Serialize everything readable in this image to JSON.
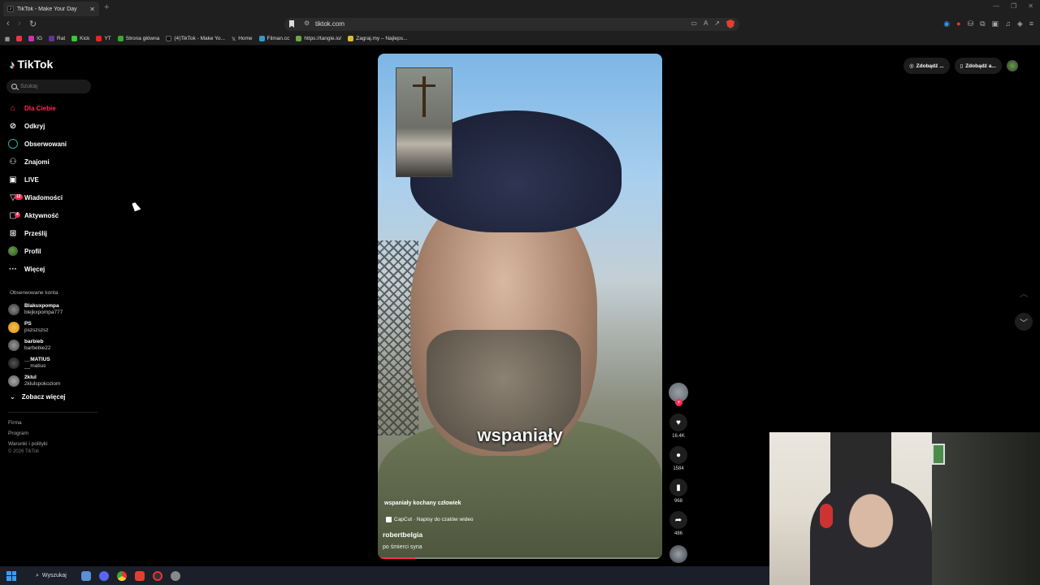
{
  "browser": {
    "tab_title": "TikTok - Make Your Day",
    "url": "tiktok.com",
    "bookmarks": [
      "IG",
      "Rat",
      "Kick",
      "YT",
      "Strona główna",
      "(4)TikTok - Make Yo...",
      "Home",
      "Filman.cc",
      "https://tangle.io/",
      "Zagraj.my – Najleps..."
    ]
  },
  "tiktok": {
    "logo": "TikTok",
    "search_placeholder": "Szukaj",
    "nav": [
      {
        "label": "Dla Ciebie",
        "icon": "home-icon"
      },
      {
        "label": "Odkryj",
        "icon": "compass-icon"
      },
      {
        "label": "Obserwowani",
        "icon": "following-icon"
      },
      {
        "label": "Znajomi",
        "icon": "friends-icon"
      },
      {
        "label": "LIVE",
        "icon": "live-icon"
      },
      {
        "label": "Wiadomości",
        "icon": "messages-icon",
        "badge": "12"
      },
      {
        "label": "Aktywność",
        "icon": "activity-icon",
        "badge": "4"
      },
      {
        "label": "Prześlij",
        "icon": "upload-icon"
      },
      {
        "label": "Profil",
        "icon": "profile-icon"
      },
      {
        "label": "Więcej",
        "icon": "more-icon"
      }
    ],
    "following_title": "Obserwowane konta",
    "accounts": [
      {
        "name": "Blakuxpompa",
        "handle": "blejkxpompa777"
      },
      {
        "name": "PS",
        "handle": "pszszszsz"
      },
      {
        "name": "barbieb",
        "handle": "barbebie22"
      },
      {
        "name": "__MATIUS",
        "handle": "__matius"
      },
      {
        "name": "2klul",
        "handle": "2klulspokoziom"
      }
    ],
    "see_more": "Zobacz więcej",
    "footer": [
      "Firma",
      "Program",
      "Warunki i polityki"
    ],
    "copyright": "© 2026 TikTok",
    "top_right": [
      "Zdobądź ...",
      "Zdobądź a..."
    ]
  },
  "video": {
    "caption": "wspaniały",
    "description": "wspaniały kochany człowiek",
    "capcut": "CapCut · Napisy do czatów wideo",
    "author": "robertbelgia",
    "subtitle": "po śmierci syna",
    "progress": 0.13,
    "likes": "16.4K",
    "comments": "1584",
    "saves": "968",
    "shares": "486"
  },
  "taskbar": {
    "search_label": "Wyszukaj"
  }
}
